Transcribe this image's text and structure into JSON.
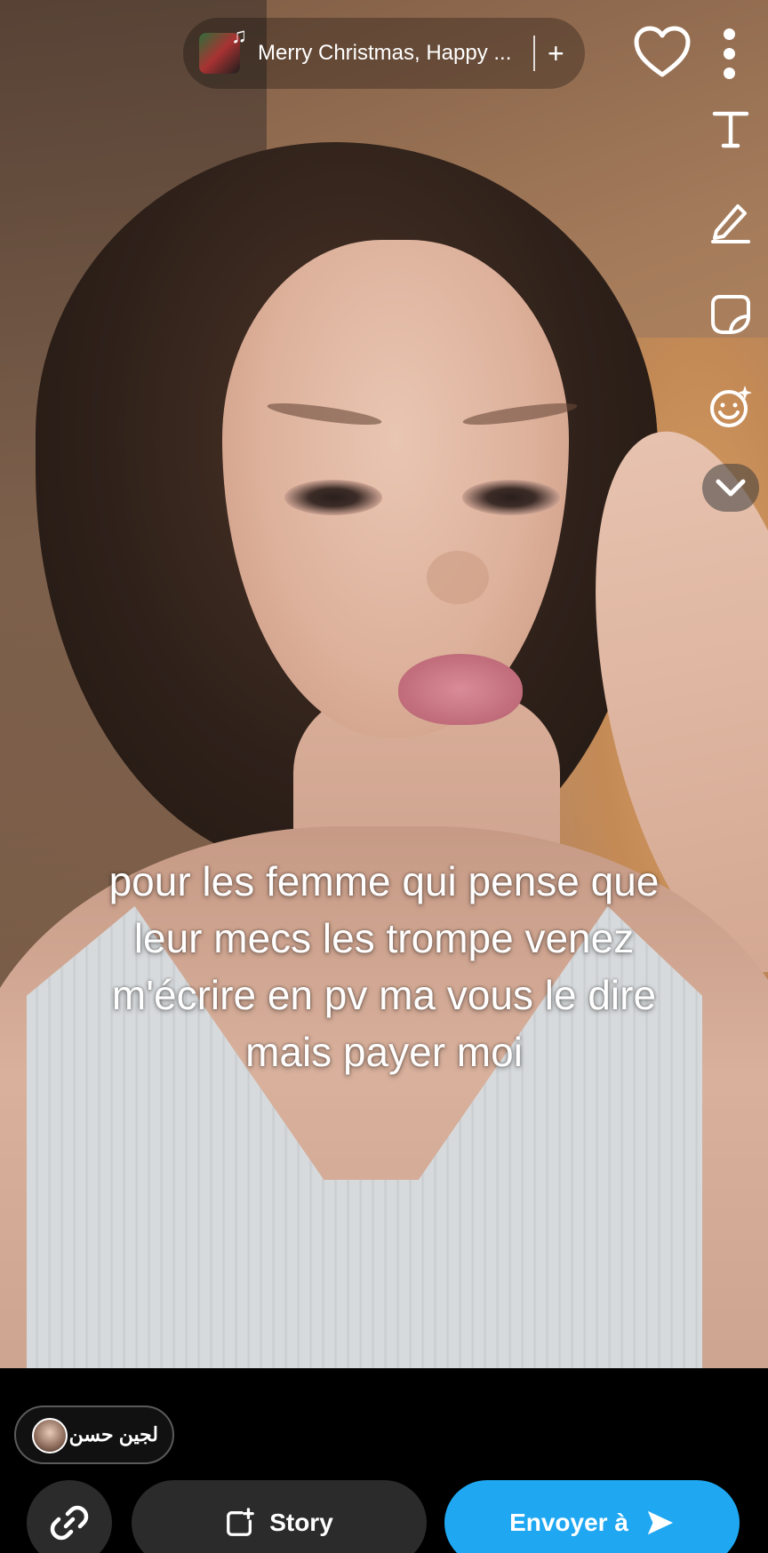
{
  "music": {
    "title": "Merry Christmas, Happy ...",
    "add_symbol": "+"
  },
  "caption": {
    "text": "pour les femme qui pense que\nleur mecs les trompe venez\nm'écrire en pv ma vous le dire\nmais payer moi"
  },
  "toolbar": {
    "icons": [
      "heart-icon",
      "more-icon",
      "text-icon",
      "pencil-icon",
      "sticker-icon",
      "emoji-sparkle-icon",
      "chevron-down-icon"
    ]
  },
  "recipient": {
    "name": "لجين حسن"
  },
  "actions": {
    "story_label": "Story",
    "send_label": "Envoyer à"
  },
  "colors": {
    "send_button": "#1fa7f2",
    "dark_button": "#2b2b2b",
    "background": "#000000"
  }
}
